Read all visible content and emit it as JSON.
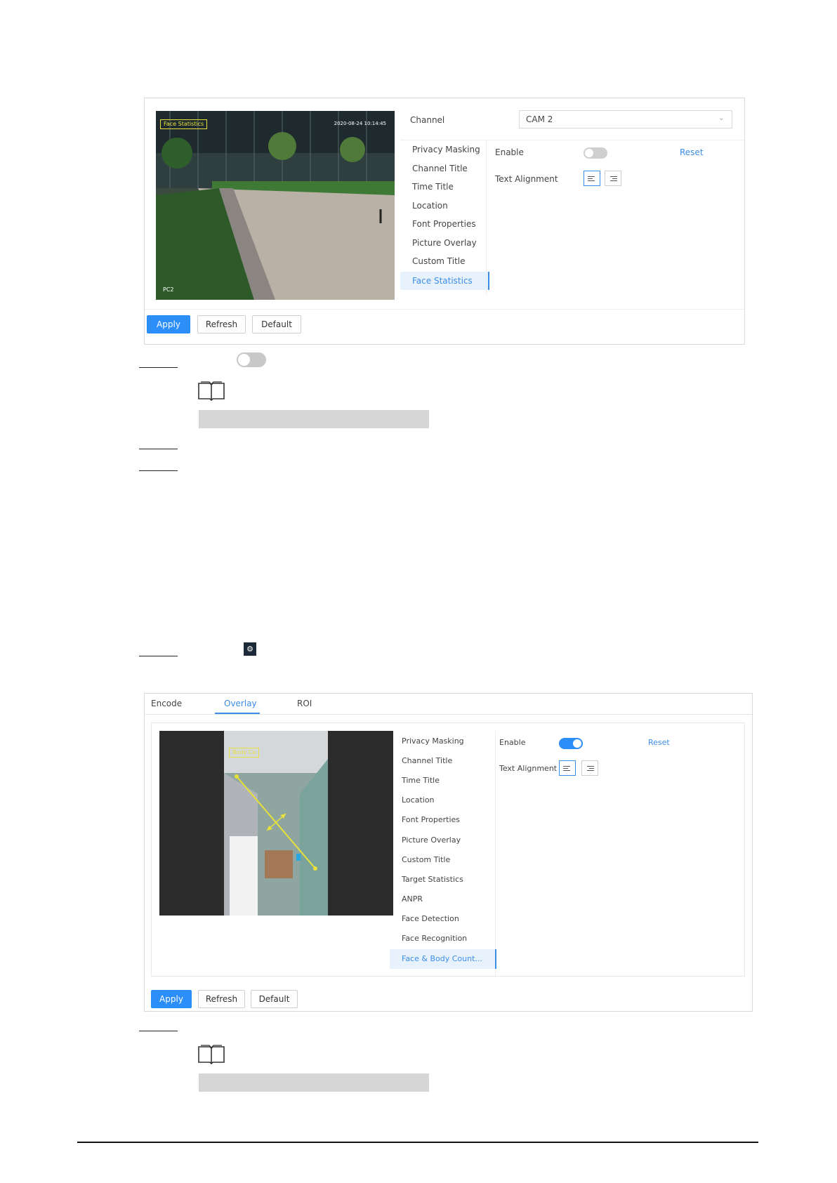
{
  "screen1": {
    "video": {
      "face_label": "Face Statistics",
      "timestamp": "2020-08-24 10:14:45",
      "corner_label": "PC2"
    },
    "channel": {
      "label": "Channel",
      "value": "CAM 2"
    },
    "menu": [
      "Privacy Masking",
      "Channel Title",
      "Time Title",
      "Location",
      "Font Properties",
      "Picture Overlay",
      "Custom Title",
      "Face Statistics"
    ],
    "enable_label": "Enable",
    "reset_label": "Reset",
    "text_alignment_label": "Text Alignment",
    "buttons": {
      "apply": "Apply",
      "refresh": "Refresh",
      "default": "Default"
    }
  },
  "screen2": {
    "tabs": [
      "Encode",
      "Overlay",
      "ROI"
    ],
    "video": {
      "body_label": "Body Co"
    },
    "menu": [
      "Privacy Masking",
      "Channel Title",
      "Time Title",
      "Location",
      "Font Properties",
      "Picture Overlay",
      "Custom Title",
      "Target Statistics",
      "ANPR",
      "Face Detection",
      "Face Recognition",
      "Face & Body Count..."
    ],
    "enable_label": "Enable",
    "reset_label": "Reset",
    "text_alignment_label": "Text Alignment",
    "buttons": {
      "apply": "Apply",
      "refresh": "Refresh",
      "default": "Default"
    }
  },
  "icons": [
    "book-icon",
    "gear-icon",
    "toggle-off-icon"
  ],
  "colors": {
    "accent": "#2c8ef8",
    "label_box": "#e8e13a"
  }
}
